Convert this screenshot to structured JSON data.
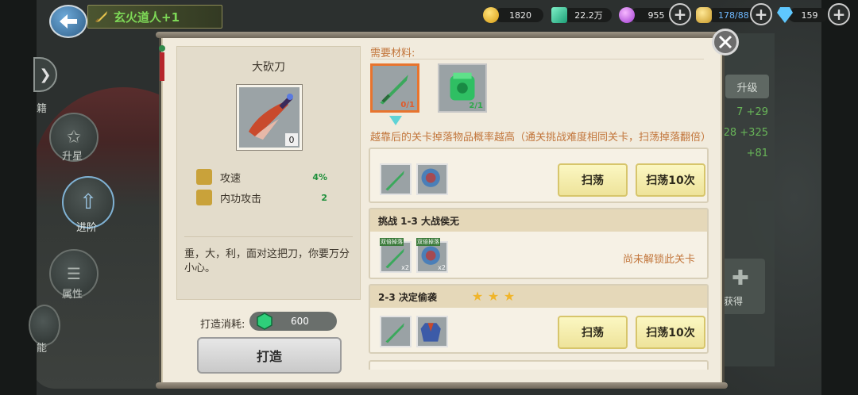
{
  "hero_tag": "玄火道人+1",
  "resources": {
    "gold": "1820",
    "jade": "22.2万",
    "orb": "955",
    "stamina": "178/88",
    "diamond": "159"
  },
  "left_menu": {
    "item1": "籍",
    "item2": "升星",
    "item3": "进阶",
    "item4": "属性",
    "item5": "能"
  },
  "right_bg": {
    "upgrade": "升级",
    "v1": "7 +29",
    "v2": "28 +325",
    "v3": "+81",
    "obtain": "获得"
  },
  "item": {
    "name": "大砍刀",
    "count": "0",
    "stats": [
      {
        "label": "攻速",
        "value": "4%"
      },
      {
        "label": "内功攻击",
        "value": "2"
      }
    ],
    "description": "重，大，利，面对这把刀，你要万分小心。"
  },
  "forge": {
    "cost_label": "打造消耗:",
    "cost_value": "600",
    "button": "打造"
  },
  "materials": {
    "title": "需要材料:",
    "items": [
      {
        "name": "sword-material",
        "count": "0/1"
      },
      {
        "name": "armor-material",
        "count": "2/1"
      }
    ],
    "hint": "越靠后的关卡掉落物品概率越高（通关挑战难度相同关卡，扫荡掉落翻倍）"
  },
  "stages": [
    {
      "title": "",
      "sweep": "扫荡",
      "sweep10": "扫荡10次"
    },
    {
      "title": "挑战 1-3 大战侯无",
      "drop_tag": "双倍掉落",
      "drop_mult": "x2",
      "locked": "尚未解锁此关卡"
    },
    {
      "title": "2-3 决定偷袭",
      "stars": 3,
      "sweep": "扫荡",
      "sweep10": "扫荡10次"
    }
  ],
  "colors": {
    "accent_orange": "#c2763c",
    "stat_green": "#1d8f3a",
    "sweep_yellow": "#eee39a"
  }
}
